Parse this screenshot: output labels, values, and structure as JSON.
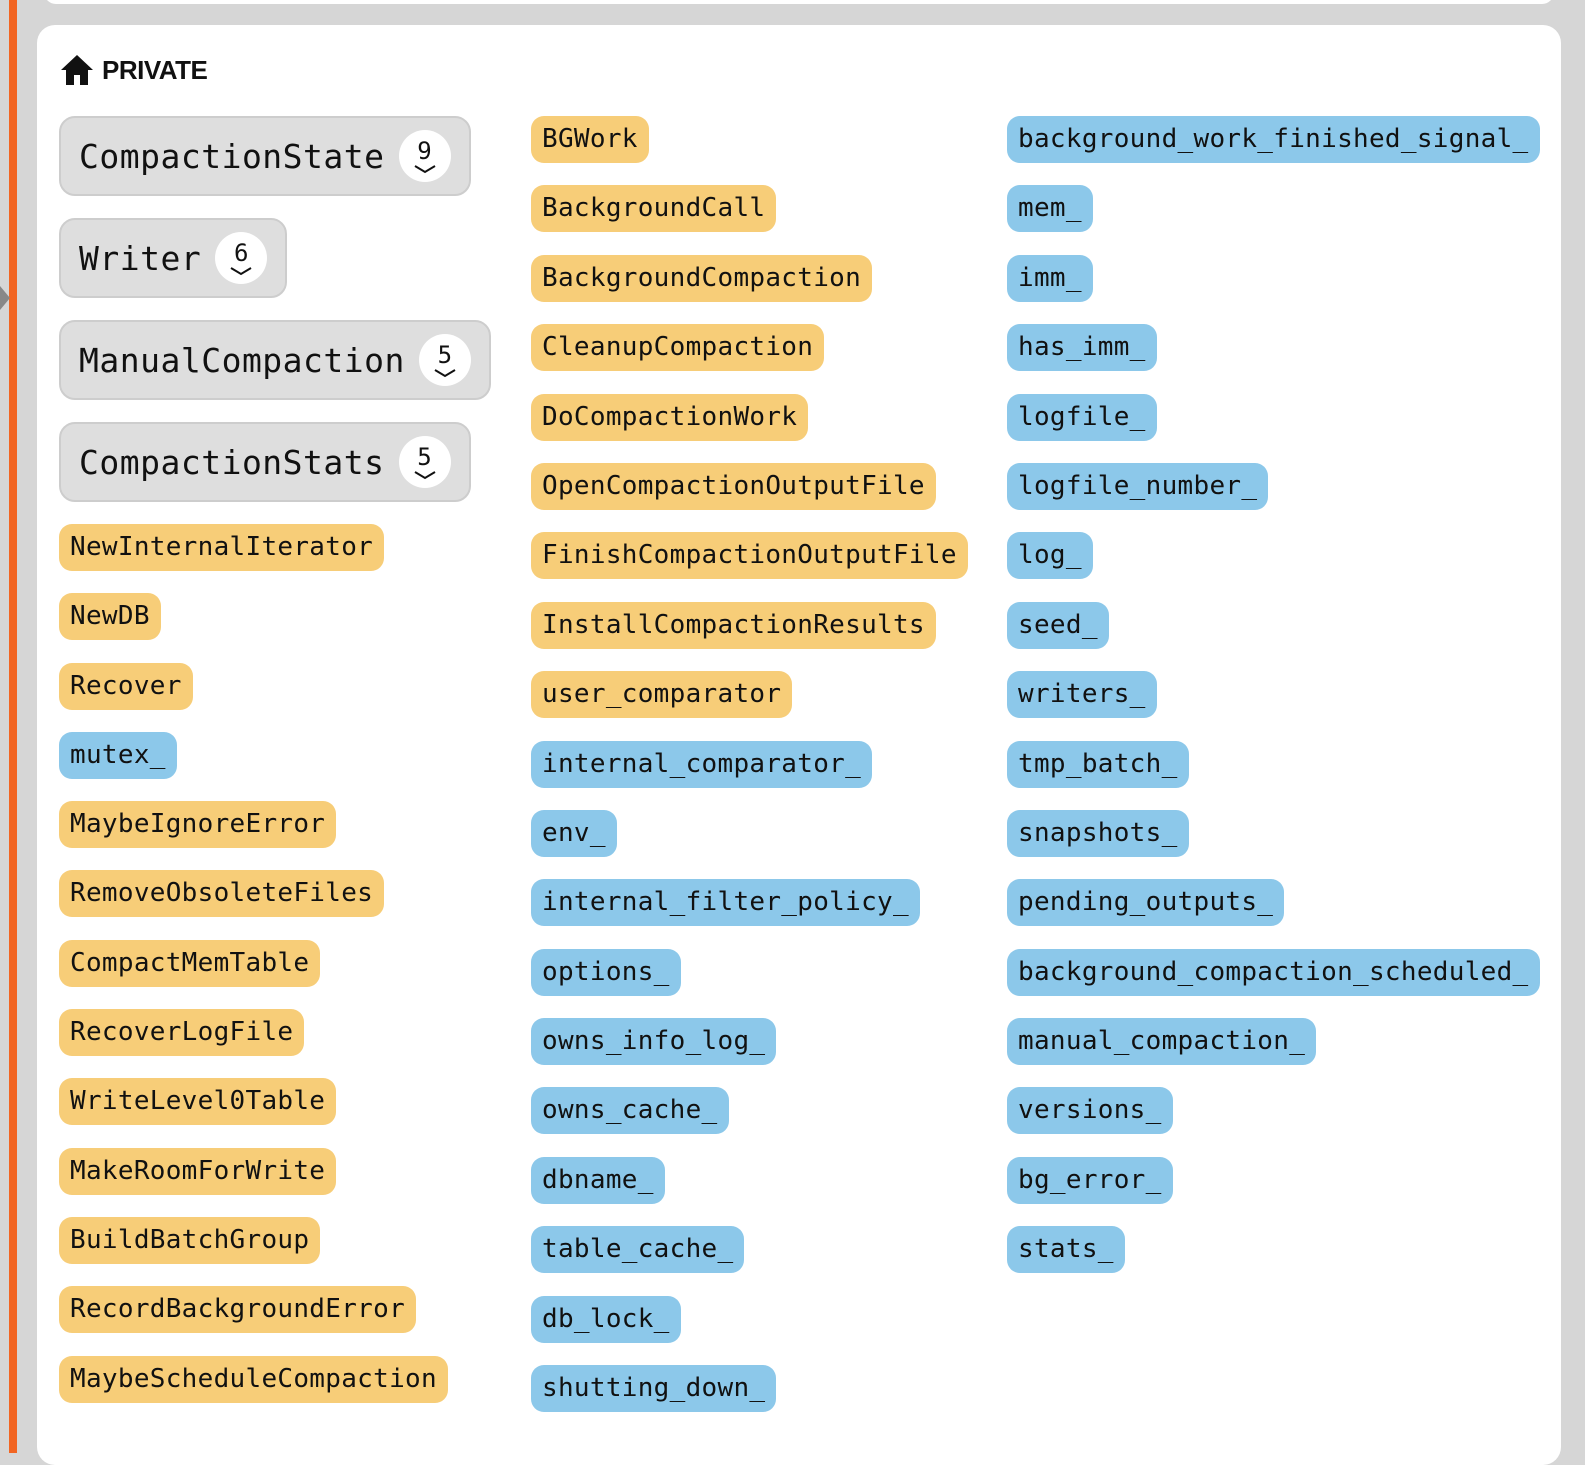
{
  "section": {
    "title": "PRIVATE",
    "icon": "house-icon"
  },
  "colors": {
    "function_pill": "#f7cd78",
    "variable_pill": "#8cc8ea",
    "accent_bar": "#f26522"
  },
  "groups": [
    {
      "label": "CompactionState",
      "count": "9"
    },
    {
      "label": "Writer",
      "count": "6"
    },
    {
      "label": "ManualCompaction",
      "count": "5"
    },
    {
      "label": "CompactionStats",
      "count": "5"
    }
  ],
  "column1": [
    {
      "label": "NewInternalIterator",
      "kind": "function"
    },
    {
      "label": "NewDB",
      "kind": "function"
    },
    {
      "label": "Recover",
      "kind": "function"
    },
    {
      "label": "mutex_",
      "kind": "variable"
    },
    {
      "label": "MaybeIgnoreError",
      "kind": "function"
    },
    {
      "label": "RemoveObsoleteFiles",
      "kind": "function"
    },
    {
      "label": "CompactMemTable",
      "kind": "function"
    },
    {
      "label": "RecoverLogFile",
      "kind": "function"
    },
    {
      "label": "WriteLevel0Table",
      "kind": "function"
    },
    {
      "label": "MakeRoomForWrite",
      "kind": "function"
    },
    {
      "label": "BuildBatchGroup",
      "kind": "function"
    },
    {
      "label": "RecordBackgroundError",
      "kind": "function"
    },
    {
      "label": "MaybeScheduleCompaction",
      "kind": "function"
    }
  ],
  "column2": [
    {
      "label": "BGWork",
      "kind": "function"
    },
    {
      "label": "BackgroundCall",
      "kind": "function"
    },
    {
      "label": "BackgroundCompaction",
      "kind": "function"
    },
    {
      "label": "CleanupCompaction",
      "kind": "function"
    },
    {
      "label": "DoCompactionWork",
      "kind": "function"
    },
    {
      "label": "OpenCompactionOutputFile",
      "kind": "function"
    },
    {
      "label": "FinishCompactionOutputFile",
      "kind": "function"
    },
    {
      "label": "InstallCompactionResults",
      "kind": "function"
    },
    {
      "label": "user_comparator",
      "kind": "function"
    },
    {
      "label": "internal_comparator_",
      "kind": "variable"
    },
    {
      "label": "env_",
      "kind": "variable"
    },
    {
      "label": "internal_filter_policy_",
      "kind": "variable"
    },
    {
      "label": "options_",
      "kind": "variable"
    },
    {
      "label": "owns_info_log_",
      "kind": "variable"
    },
    {
      "label": "owns_cache_",
      "kind": "variable"
    },
    {
      "label": "dbname_",
      "kind": "variable"
    },
    {
      "label": "table_cache_",
      "kind": "variable"
    },
    {
      "label": "db_lock_",
      "kind": "variable"
    },
    {
      "label": "shutting_down_",
      "kind": "variable"
    }
  ],
  "column3": [
    {
      "label": "background_work_finished_signal_",
      "kind": "variable"
    },
    {
      "label": "mem_",
      "kind": "variable"
    },
    {
      "label": "imm_",
      "kind": "variable"
    },
    {
      "label": "has_imm_",
      "kind": "variable"
    },
    {
      "label": "logfile_",
      "kind": "variable"
    },
    {
      "label": "logfile_number_",
      "kind": "variable"
    },
    {
      "label": "log_",
      "kind": "variable"
    },
    {
      "label": "seed_",
      "kind": "variable"
    },
    {
      "label": "writers_",
      "kind": "variable"
    },
    {
      "label": "tmp_batch_",
      "kind": "variable"
    },
    {
      "label": "snapshots_",
      "kind": "variable"
    },
    {
      "label": "pending_outputs_",
      "kind": "variable"
    },
    {
      "label": "background_compaction_scheduled_",
      "kind": "variable"
    },
    {
      "label": "manual_compaction_",
      "kind": "variable"
    },
    {
      "label": "versions_",
      "kind": "variable"
    },
    {
      "label": "bg_error_",
      "kind": "variable"
    },
    {
      "label": "stats_",
      "kind": "variable"
    }
  ]
}
